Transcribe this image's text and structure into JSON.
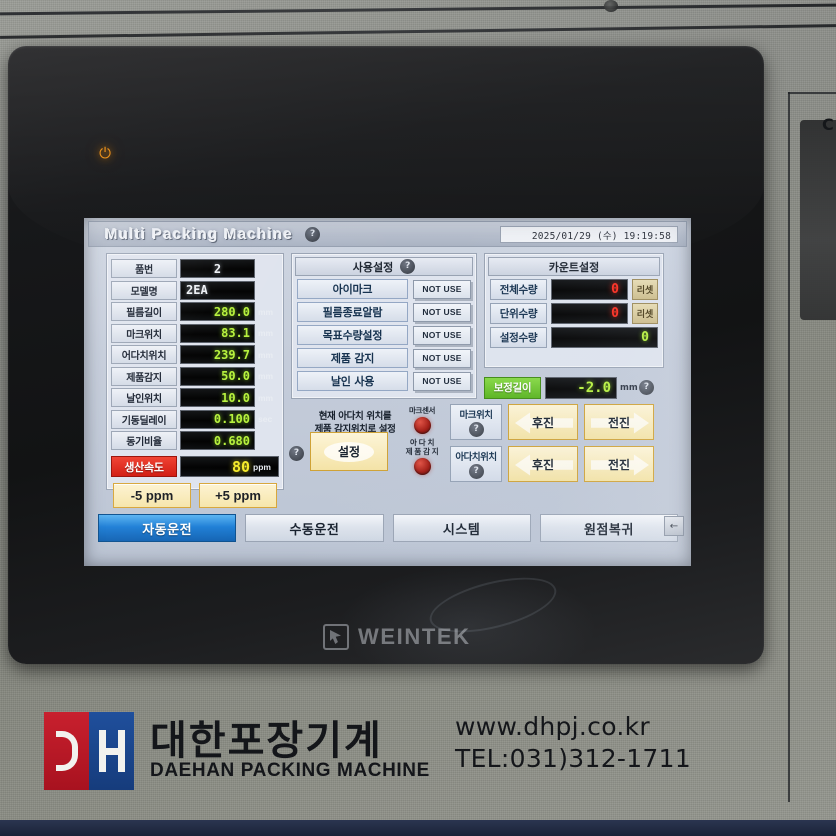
{
  "device": {
    "power_led": "power-icon",
    "hmi_brand": "WEINTEK"
  },
  "screen": {
    "app_title": "Multi Packing Machine",
    "title_help": "?",
    "datetime": "2025/01/29 (수) 19:19:58"
  },
  "left_panel": {
    "rows": [
      {
        "label": "품번",
        "value": "2",
        "unit": "",
        "align": "center",
        "color": "white"
      },
      {
        "label": "모델명",
        "value": "2EA",
        "unit": "",
        "align": "left",
        "color": "white"
      },
      {
        "label": "필름길이",
        "value": "280.0",
        "unit": "mm",
        "align": "right",
        "color": "green"
      },
      {
        "label": "마크위치",
        "value": "83.1",
        "unit": "mm",
        "align": "right",
        "color": "green"
      },
      {
        "label": "어다치위치",
        "value": "239.7",
        "unit": "mm",
        "align": "right",
        "color": "green"
      },
      {
        "label": "제품감지",
        "value": "50.0",
        "unit": "mm",
        "align": "right",
        "color": "green"
      },
      {
        "label": "날인위치",
        "value": "10.0",
        "unit": "mm",
        "align": "right",
        "color": "green"
      },
      {
        "label": "기동딜레이",
        "value": "0.100",
        "unit": "sec",
        "align": "right",
        "color": "green"
      },
      {
        "label": "동기비율",
        "value": "0.680",
        "unit": "",
        "align": "right",
        "color": "green"
      }
    ],
    "speed": {
      "label": "생산속도",
      "value": "80",
      "unit": "ppm"
    },
    "speed_down": "-5 ppm",
    "speed_up": "+5 ppm"
  },
  "mid_panel": {
    "header": "사용설정",
    "header_help": "?",
    "rows": [
      {
        "label": "아이마크",
        "value": "NOT USE"
      },
      {
        "label": "필름종료알람",
        "value": "NOT USE"
      },
      {
        "label": "목표수량설정",
        "value": "NOT USE"
      },
      {
        "label": "제품 감지",
        "value": "NOT USE"
      },
      {
        "label": "날인 사용",
        "value": "NOT USE"
      }
    ]
  },
  "right_panel": {
    "header": "카운트설정",
    "rows": [
      {
        "label": "전체수량",
        "value": "0",
        "color": "red",
        "reset": "리셋"
      },
      {
        "label": "단위수량",
        "value": "0",
        "color": "red",
        "reset": "리셋"
      },
      {
        "label": "설정수량",
        "value": "0",
        "color": "green",
        "reset": ""
      }
    ],
    "correction": {
      "label": "보정길이",
      "value": "-2.0",
      "unit": "mm",
      "help": "?"
    }
  },
  "controls": {
    "set_text_line1": "현재 아다치 위치를",
    "set_text_line2": "제품 감지위치로 설정",
    "set_help": "?",
    "set_button": "설정",
    "lamps": [
      {
        "caption_line1": "마크센서",
        "caption_line2": ""
      },
      {
        "caption_line1": "아 다 치",
        "caption_line2": "제 품 감 지"
      }
    ],
    "jog_rows": [
      {
        "label": "마크위치",
        "help": "?",
        "reverse": "후진",
        "forward": "전진"
      },
      {
        "label": "아다치위치",
        "help": "?",
        "reverse": "후진",
        "forward": "전진"
      }
    ]
  },
  "tabs": [
    {
      "label": "자동운전",
      "active": true
    },
    {
      "label": "수동운전",
      "active": false
    },
    {
      "label": "시스템",
      "active": false
    },
    {
      "label": "원점복귀",
      "active": false
    }
  ],
  "back_button": "←",
  "plate": {
    "logo_left": "D",
    "logo_right": "H",
    "ko_name": "대한포장기계",
    "en_name": "DAEHAN PACKING MACHINE",
    "website": "www.dhpj.co.kr",
    "tel": "TEL:031)312-1711"
  },
  "colors": {
    "active_tab": "#1f7fd6",
    "alarm_red": "#d21b10",
    "lcd_green": "#b7f23c",
    "lcd_red": "#ff2a1c",
    "correction_green": "#58b41d",
    "button_amber": "#f4e3a6"
  }
}
